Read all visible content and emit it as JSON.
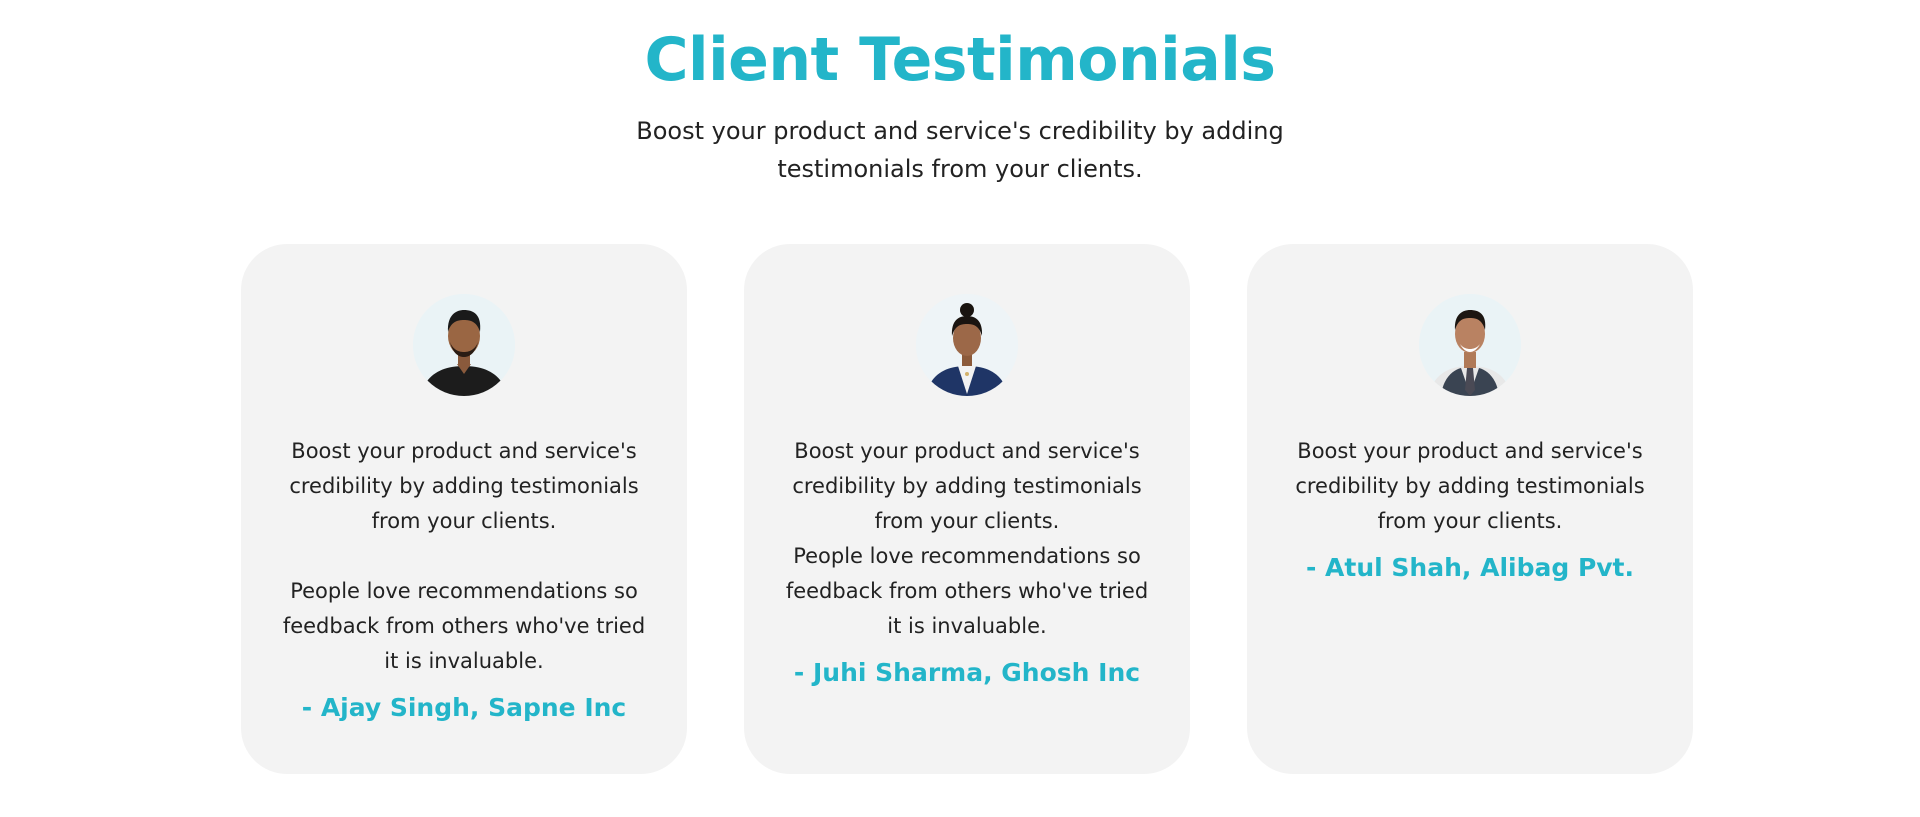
{
  "header": {
    "title": "Client Testimonials",
    "subtitle": "Boost your product and service's credibility by adding testimonials from your clients."
  },
  "colors": {
    "accent": "#23b5c9",
    "card_background": "#f3f3f3",
    "text": "#222222"
  },
  "testimonials": [
    {
      "paragraph_1": "Boost your product and service's credibility by adding testimonials from your clients.",
      "paragraph_2": "People love recommendations so feedback from others who've tried it is invaluable.",
      "author": "- Ajay Singh, Sapne Inc",
      "avatar_icon": "man-black-shirt-avatar"
    },
    {
      "paragraph_1": "Boost your product and service's credibility by adding testimonials from your clients.",
      "paragraph_2": "People love recommendations so feedback from others who've tried it is invaluable.",
      "author": "- Juhi Sharma, Ghosh Inc",
      "avatar_icon": "woman-blazer-avatar"
    },
    {
      "paragraph_1": "Boost your product and service's credibility by adding testimonials from your clients.",
      "author": "- Atul Shah, Alibag Pvt.",
      "avatar_icon": "man-vest-tie-avatar"
    }
  ]
}
